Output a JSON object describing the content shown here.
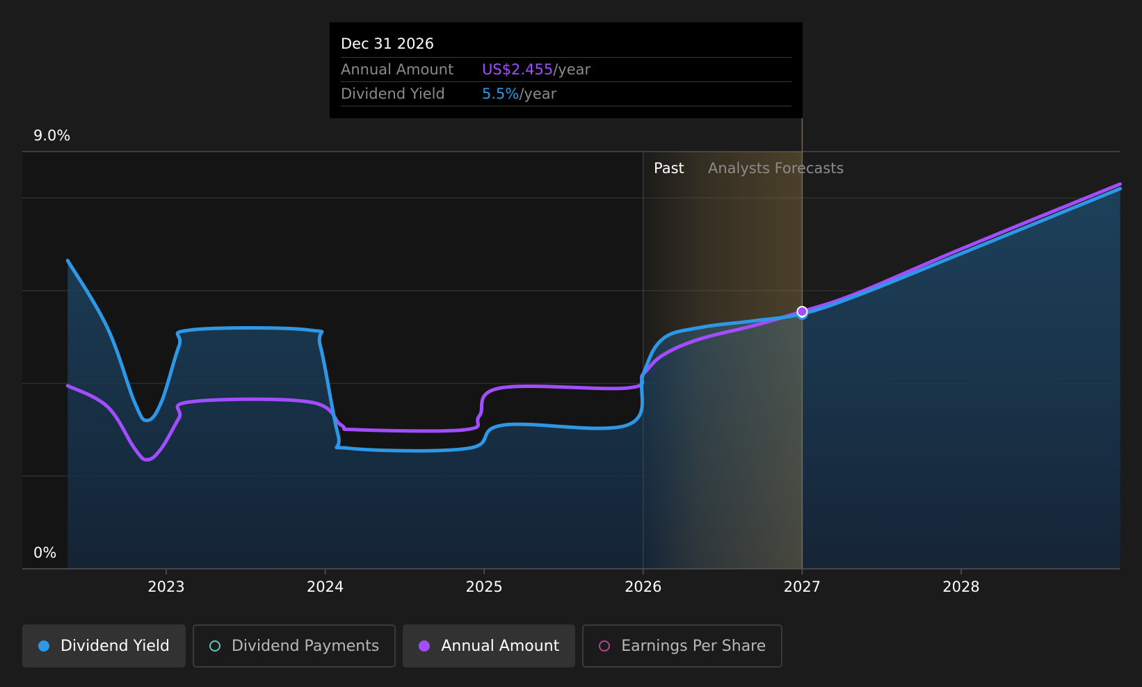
{
  "tooltip": {
    "date": "Dec 31 2026",
    "annual_amount_label": "Annual Amount",
    "annual_amount_value": "US$2.455",
    "annual_amount_unit": "/year",
    "dividend_yield_label": "Dividend Yield",
    "dividend_yield_value": "5.5%",
    "dividend_yield_unit": "/year"
  },
  "region_labels": {
    "past": "Past",
    "forecast": "Analysts Forecasts"
  },
  "legend": [
    {
      "label": "Dividend Yield",
      "active": true,
      "color": "#2e98e6"
    },
    {
      "label": "Dividend Payments",
      "active": false,
      "color": "#5fc9b8"
    },
    {
      "label": "Annual Amount",
      "active": true,
      "color": "#a24dff"
    },
    {
      "label": "Earnings Per Share",
      "active": false,
      "color": "#b0488f"
    }
  ],
  "chart_data": {
    "type": "line",
    "y_tick_labels": [
      "9.0%",
      "0%"
    ],
    "ylim": [
      0,
      9.0
    ],
    "x_tick_labels": [
      "2023",
      "2024",
      "2025",
      "2026",
      "2027",
      "2028"
    ],
    "x_ticks": [
      2023,
      2024,
      2025,
      2026,
      2027,
      2028
    ],
    "xlim": [
      2022.1,
      2029.0
    ],
    "past_end": 2026.0,
    "forecast_shade_end": 2027.0,
    "highlight_x": 2027.0,
    "colors": {
      "yield": "#2e98e6",
      "amount": "#a24dff",
      "forecast_shade": "#c8a050"
    },
    "series": [
      {
        "key": "yield",
        "label": "Dividend Yield",
        "points": [
          [
            2022.38,
            6.65
          ],
          [
            2022.63,
            5.2
          ],
          [
            2022.8,
            3.6
          ],
          [
            2022.88,
            3.2
          ],
          [
            2022.97,
            3.6
          ],
          [
            2023.08,
            4.8
          ],
          [
            2023.15,
            5.15
          ],
          [
            2023.9,
            5.15
          ],
          [
            2023.97,
            4.8
          ],
          [
            2024.08,
            2.9
          ],
          [
            2024.15,
            2.6
          ],
          [
            2024.9,
            2.6
          ],
          [
            2025.12,
            3.1
          ],
          [
            2025.9,
            3.1
          ],
          [
            2026.0,
            4.2
          ],
          [
            2026.12,
            4.95
          ],
          [
            2026.35,
            5.2
          ],
          [
            2026.7,
            5.35
          ],
          [
            2027.0,
            5.5
          ],
          [
            2027.35,
            5.9
          ],
          [
            2028.0,
            6.8
          ],
          [
            2029.0,
            8.2
          ]
        ]
      },
      {
        "key": "amount",
        "label": "Annual Amount",
        "points": [
          [
            2022.38,
            3.95
          ],
          [
            2022.63,
            3.5
          ],
          [
            2022.8,
            2.6
          ],
          [
            2022.88,
            2.35
          ],
          [
            2022.97,
            2.6
          ],
          [
            2023.08,
            3.25
          ],
          [
            2023.15,
            3.6
          ],
          [
            2023.9,
            3.6
          ],
          [
            2024.1,
            3.1
          ],
          [
            2024.2,
            3.0
          ],
          [
            2024.88,
            3.0
          ],
          [
            2024.97,
            3.3
          ],
          [
            2025.1,
            3.9
          ],
          [
            2025.9,
            3.9
          ],
          [
            2026.0,
            4.2
          ],
          [
            2026.12,
            4.6
          ],
          [
            2026.35,
            4.95
          ],
          [
            2026.7,
            5.25
          ],
          [
            2027.0,
            5.55
          ],
          [
            2027.35,
            5.95
          ],
          [
            2028.0,
            6.9
          ],
          [
            2029.0,
            8.3
          ]
        ]
      }
    ]
  }
}
